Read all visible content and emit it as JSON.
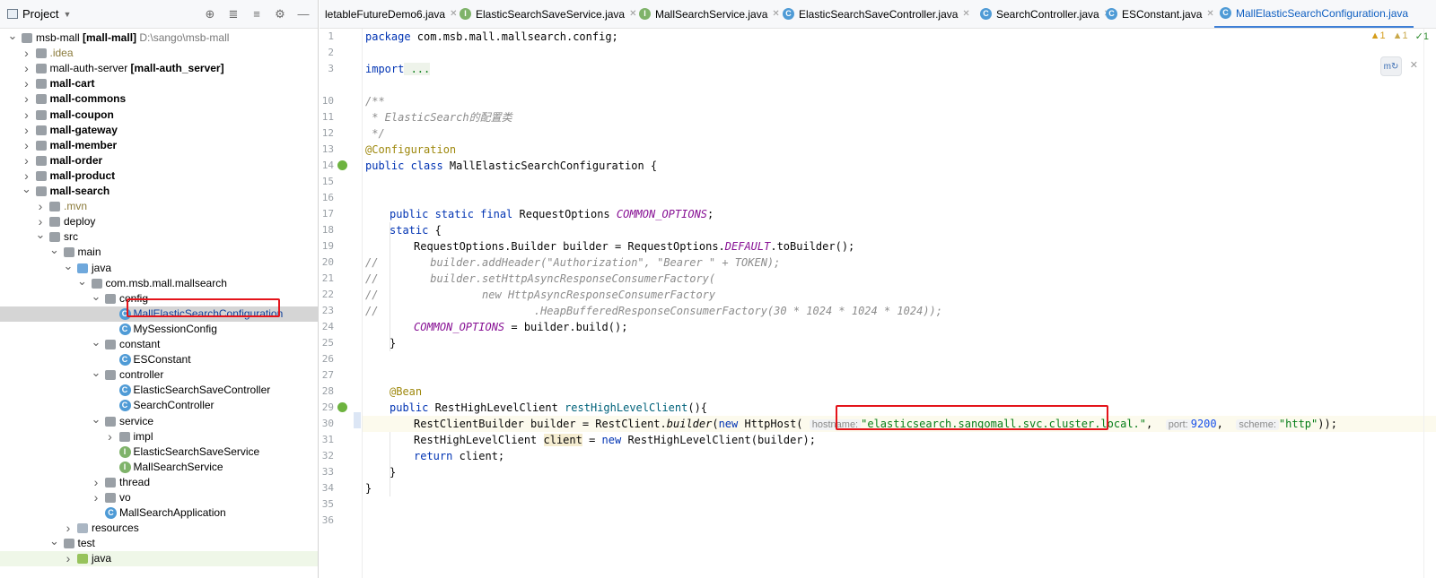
{
  "project": {
    "title": "Project",
    "tools": [
      "target-icon",
      "expand-all-icon",
      "collapse-all-icon",
      "gear-icon",
      "hide-icon"
    ]
  },
  "tree": [
    {
      "indent": 0,
      "arrow": "v",
      "icon": "folder",
      "label": "msb-mall",
      "bold": "[mall-mall]",
      "path": "D:\\sango\\msb-mall"
    },
    {
      "indent": 1,
      "arrow": ">",
      "icon": "folder",
      "label": ".idea",
      "dim": true
    },
    {
      "indent": 1,
      "arrow": ">",
      "icon": "folder",
      "label": "mall-auth-server",
      "bold": "[mall-auth_server]"
    },
    {
      "indent": 1,
      "arrow": ">",
      "icon": "folder",
      "label": "mall-cart",
      "allbold": true
    },
    {
      "indent": 1,
      "arrow": ">",
      "icon": "folder",
      "label": "mall-commons",
      "allbold": true
    },
    {
      "indent": 1,
      "arrow": ">",
      "icon": "folder",
      "label": "mall-coupon",
      "allbold": true
    },
    {
      "indent": 1,
      "arrow": ">",
      "icon": "folder",
      "label": "mall-gateway",
      "allbold": true
    },
    {
      "indent": 1,
      "arrow": ">",
      "icon": "folder",
      "label": "mall-member",
      "allbold": true
    },
    {
      "indent": 1,
      "arrow": ">",
      "icon": "folder",
      "label": "mall-order",
      "allbold": true
    },
    {
      "indent": 1,
      "arrow": ">",
      "icon": "folder",
      "label": "mall-product",
      "allbold": true
    },
    {
      "indent": 1,
      "arrow": "v",
      "icon": "folder",
      "label": "mall-search",
      "allbold": true
    },
    {
      "indent": 2,
      "arrow": ">",
      "icon": "folder",
      "label": ".mvn",
      "dim": true
    },
    {
      "indent": 2,
      "arrow": ">",
      "icon": "folder",
      "label": "deploy"
    },
    {
      "indent": 2,
      "arrow": "v",
      "icon": "folder",
      "label": "src"
    },
    {
      "indent": 3,
      "arrow": "v",
      "icon": "folder",
      "label": "main"
    },
    {
      "indent": 4,
      "arrow": "v",
      "icon": "folder-blue",
      "label": "java"
    },
    {
      "indent": 5,
      "arrow": "v",
      "icon": "folder",
      "label": "com.msb.mall.mallsearch"
    },
    {
      "indent": 6,
      "arrow": "v",
      "icon": "folder",
      "label": "config"
    },
    {
      "indent": 7,
      "arrow": "",
      "icon": "class",
      "label": "MallElasticSearchConfiguration",
      "selected": true
    },
    {
      "indent": 7,
      "arrow": "",
      "icon": "class",
      "label": "MySessionConfig"
    },
    {
      "indent": 6,
      "arrow": "v",
      "icon": "folder",
      "label": "constant"
    },
    {
      "indent": 7,
      "arrow": "",
      "icon": "class",
      "label": "ESConstant"
    },
    {
      "indent": 6,
      "arrow": "v",
      "icon": "folder",
      "label": "controller"
    },
    {
      "indent": 7,
      "arrow": "",
      "icon": "class",
      "label": "ElasticSearchSaveController"
    },
    {
      "indent": 7,
      "arrow": "",
      "icon": "class",
      "label": "SearchController"
    },
    {
      "indent": 6,
      "arrow": "v",
      "icon": "folder",
      "label": "service"
    },
    {
      "indent": 7,
      "arrow": ">",
      "icon": "folder",
      "label": "impl"
    },
    {
      "indent": 7,
      "arrow": "",
      "icon": "interface",
      "label": "ElasticSearchSaveService"
    },
    {
      "indent": 7,
      "arrow": "",
      "icon": "interface",
      "label": "MallSearchService"
    },
    {
      "indent": 6,
      "arrow": ">",
      "icon": "folder",
      "label": "thread"
    },
    {
      "indent": 6,
      "arrow": ">",
      "icon": "folder",
      "label": "vo"
    },
    {
      "indent": 6,
      "arrow": "",
      "icon": "spring",
      "label": "MallSearchApplication"
    },
    {
      "indent": 4,
      "arrow": ">",
      "icon": "folder-res",
      "label": "resources"
    },
    {
      "indent": 3,
      "arrow": "v",
      "icon": "folder",
      "label": "test"
    },
    {
      "indent": 4,
      "arrow": ">",
      "icon": "folder-green",
      "label": "java",
      "green": true
    }
  ],
  "tabs": [
    {
      "label": "letableFutureDemo6.java",
      "icon": "none"
    },
    {
      "label": "ElasticSearchSaveService.java",
      "icon": "interface"
    },
    {
      "label": "MallSearchService.java",
      "icon": "interface"
    },
    {
      "label": "ElasticSearchSaveController.java",
      "icon": "class"
    },
    {
      "label": "SearchController.java",
      "icon": "class"
    },
    {
      "label": "ESConstant.java",
      "icon": "class"
    },
    {
      "label": "MallElasticSearchConfiguration.java",
      "icon": "class",
      "active": true
    }
  ],
  "indicators": {
    "warn1": "1",
    "warn2": "1",
    "ok": "1"
  },
  "line_numbers": [
    "1",
    "2",
    "3",
    "10",
    "11",
    "12",
    "13",
    "14",
    "15",
    "16",
    "17",
    "18",
    "19",
    "20",
    "21",
    "22",
    "23",
    "24",
    "25",
    "26",
    "27",
    "28",
    "29",
    "30",
    "31",
    "32",
    "33",
    "34",
    "35",
    "36"
  ],
  "code": {
    "l1_kw": "package",
    "l1_rest": " com.msb.mall.mallsearch.config;",
    "l3_kw": "import",
    "l3_rest": " ...",
    "l11": "/**",
    "l12": " * ElasticSearch的配置类",
    "l13": " */",
    "l14": "@Configuration",
    "l15_kw": "public class",
    "l15_rest": " MallElasticSearchConfiguration {",
    "l18_kw": "public static final",
    "l18_type": " RequestOptions ",
    "l18_const": "COMMON_OPTIONS",
    "l18_end": ";",
    "l19_kw": "static",
    "l19_rest": " {",
    "l20_a": "RequestOptions.Builder builder = RequestOptions.",
    "l20_const": "DEFAULT",
    "l20_b": ".toBuilder();",
    "l21": "//        builder.addHeader(\"Authorization\", \"Bearer \" + TOKEN);",
    "l22": "//        builder.setHttpAsyncResponseConsumerFactory(",
    "l23": "//                new HttpAsyncResponseConsumerFactory",
    "l24": "//                        .HeapBufferedResponseConsumerFactory(30 * 1024 * 1024 * 1024));",
    "l25_const": "COMMON_OPTIONS",
    "l25_rest": " = builder.build();",
    "l26": "}",
    "l29": "@Bean",
    "l30_kw": "public",
    "l30_type": " RestHighLevelClient ",
    "l30_method": "restHighLevelClient",
    "l30_end": "(){",
    "l31_a": "RestClientBuilder builder = RestClient.",
    "l31_m": "builder",
    "l31_b": "(",
    "l31_new": "new",
    "l31_c": " HttpHost( ",
    "l31_hint1": "hostname:",
    "l31_str": "\"elasticsearch.sangomall.svc.cluster.local.\"",
    "l31_comma": ",  ",
    "l31_hint2": "port:",
    "l31_num": "9200",
    "l31_comma2": ",  ",
    "l31_hint3": "scheme:",
    "l31_str2": "\"http\"",
    "l31_end": "));",
    "l32_a": "RestHighLevelClient ",
    "l32_var": "client",
    "l32_b": " = ",
    "l32_new": "new",
    "l32_c": " RestHighLevelClient(builder);",
    "l33_kw": "return",
    "l33_rest": " client;",
    "l34": "}",
    "l35": "}"
  }
}
